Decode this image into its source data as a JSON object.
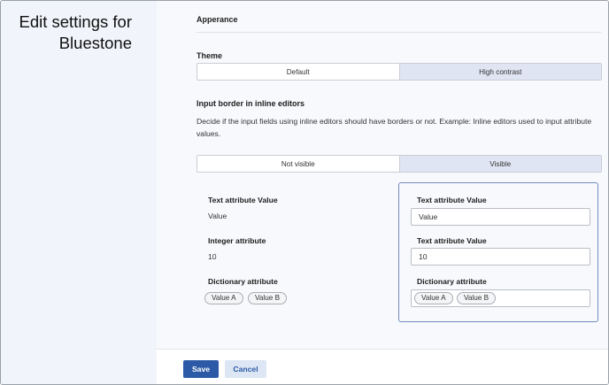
{
  "sidebar": {
    "title": "Edit settings for Bluestone"
  },
  "appearance": {
    "heading": "Apperance"
  },
  "theme": {
    "label": "Theme",
    "options": [
      "Default",
      "High contrast"
    ],
    "selected": "High contrast"
  },
  "input_border": {
    "label": "Input border in inline editors",
    "description": "Decide if the input fields using inline editors should have borders or not. Example: Inline editors used to input attribute values.",
    "options": [
      "Not visible",
      "Visible"
    ],
    "selected": "Visible"
  },
  "preview_plain": {
    "text_label": "Text attribute Value",
    "text_value": "Value",
    "integer_label": "Integer attribute",
    "integer_value": "10",
    "dictionary_label": "Dictionary attribute",
    "chips": [
      "Value A",
      "Value B"
    ]
  },
  "preview_bordered": {
    "text_label": "Text attribute Value",
    "text_value": "Value",
    "integer_label": "Text attribute Value",
    "integer_value": "10",
    "dictionary_label": "Dictionary attribute",
    "chips": [
      "Value A",
      "Value B"
    ]
  },
  "footer": {
    "save_label": "Save",
    "cancel_label": "Cancel"
  },
  "colors": {
    "primary": "#2d5aa6",
    "selected_segment": "#dfe5f3",
    "sidebar_bg": "#f1f4fa",
    "preview_border": "#6f8dbf"
  }
}
